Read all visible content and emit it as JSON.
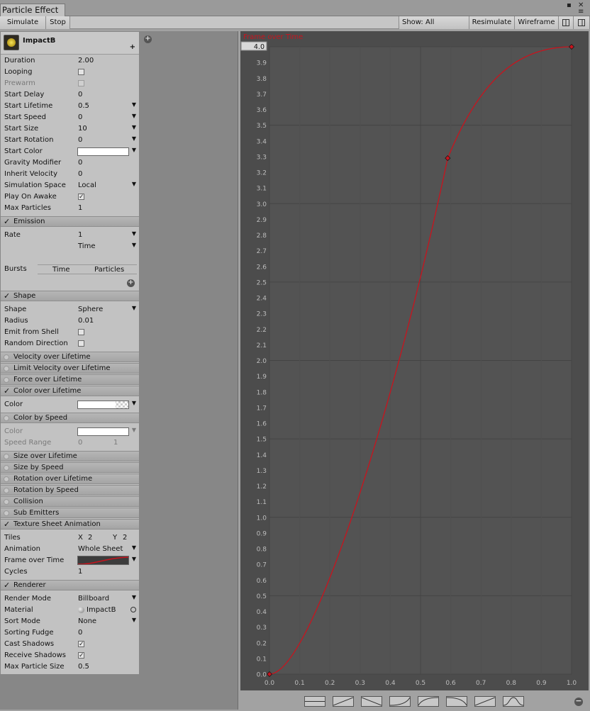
{
  "window": {
    "tab_title": "Particle Effect",
    "maximize_glyph": "▪",
    "close_glyph": "✕",
    "menu_glyph": "≡"
  },
  "toolbar": {
    "simulate": "Simulate",
    "stop": "Stop",
    "show": "Show: All",
    "resimulate": "Resimulate",
    "wireframe": "Wireframe"
  },
  "header": {
    "name": "ImpactB",
    "plus": "+"
  },
  "main_props": [
    {
      "label": "Duration",
      "value": "2.00"
    },
    {
      "label": "Looping",
      "check": ""
    },
    {
      "label": "Prewarm",
      "check": ""
    },
    {
      "label": "Start Delay",
      "value": "0"
    },
    {
      "label": "Start Lifetime",
      "value": "0.5"
    },
    {
      "label": "Start Speed",
      "value": "0"
    },
    {
      "label": "Start Size",
      "value": "10"
    },
    {
      "label": "Start Rotation",
      "value": "0"
    },
    {
      "label": "Start Color"
    },
    {
      "label": "Gravity Modifier",
      "value": "0"
    },
    {
      "label": "Inherit Velocity",
      "value": "0"
    },
    {
      "label": "Simulation Space",
      "value": "Local"
    },
    {
      "label": "Play On Awake",
      "check": "✓"
    },
    {
      "label": "Max Particles",
      "value": "1"
    }
  ],
  "emission": {
    "title": "Emission",
    "rate_label": "Rate",
    "rate_value": "1",
    "rate_unit": "Time",
    "bursts_label": "Bursts",
    "col_time": "Time",
    "col_particles": "Particles"
  },
  "shape": {
    "title": "Shape",
    "props": [
      {
        "label": "Shape",
        "value": "Sphere"
      },
      {
        "label": "Radius",
        "value": "0.01"
      },
      {
        "label": "Emit from Shell",
        "check": ""
      },
      {
        "label": "Random Direction",
        "check": ""
      }
    ]
  },
  "modules": {
    "velocity": "Velocity over Lifetime",
    "limit_velocity": "Limit Velocity over Lifetime",
    "force": "Force over Lifetime",
    "color_lifetime": "Color over Lifetime",
    "color_lifetime_color": "Color",
    "color_speed": "Color by Speed",
    "color_speed_color": "Color",
    "speed_range": "Speed Range",
    "speed_range_min": "0",
    "speed_range_max": "1",
    "size_lifetime": "Size over Lifetime",
    "size_speed": "Size by Speed",
    "rotation_lifetime": "Rotation over Lifetime",
    "rotation_speed": "Rotation by Speed",
    "collision": "Collision",
    "sub_emitters": "Sub Emitters"
  },
  "texture_sheet": {
    "title": "Texture Sheet Animation",
    "tiles_label": "Tiles",
    "tiles_x_label": "X",
    "tiles_x": "2",
    "tiles_y_label": "Y",
    "tiles_y": "2",
    "animation_label": "Animation",
    "animation_value": "Whole Sheet",
    "frame_label": "Frame over Time",
    "cycles_label": "Cycles",
    "cycles_value": "1"
  },
  "renderer": {
    "title": "Renderer",
    "props": [
      {
        "label": "Render Mode",
        "value": "Billboard"
      },
      {
        "label": "Material",
        "value": "ImpactB"
      },
      {
        "label": "Sort Mode",
        "value": "None"
      },
      {
        "label": "Sorting Fudge",
        "value": "0"
      },
      {
        "label": "Cast Shadows",
        "check": "✓"
      },
      {
        "label": "Receive Shadows",
        "check": "✓"
      },
      {
        "label": "Max Particle Size",
        "value": "0.5"
      }
    ]
  },
  "curve_editor": {
    "title": "Frame over Time",
    "max_field": "4.0",
    "y_ticks": [
      "0.0",
      "0.1",
      "0.2",
      "0.3",
      "0.4",
      "0.5",
      "0.6",
      "0.7",
      "0.8",
      "0.9",
      "1.0",
      "1.1",
      "1.2",
      "1.3",
      "1.4",
      "1.5",
      "1.6",
      "1.7",
      "1.8",
      "1.9",
      "2.0",
      "2.1",
      "2.2",
      "2.3",
      "2.4",
      "2.5",
      "2.6",
      "2.7",
      "2.8",
      "2.9",
      "3.0",
      "3.1",
      "3.2",
      "3.3",
      "3.4",
      "3.5",
      "3.6",
      "3.7",
      "3.8",
      "3.9"
    ],
    "x_ticks": [
      "0.0",
      "0.1",
      "0.2",
      "0.3",
      "0.4",
      "0.5",
      "0.6",
      "0.7",
      "0.8",
      "0.9",
      "1.0"
    ],
    "keys": [
      {
        "t": 0.0,
        "v": 0.0
      },
      {
        "t": 0.59,
        "v": 3.29
      },
      {
        "t": 1.0,
        "v": 4.0
      }
    ],
    "curve_color": "#c8141e",
    "presets": [
      "flat",
      "linear-up",
      "linear-down",
      "ease-in",
      "ease-out",
      "ease-down",
      "linear-up-2",
      "sine"
    ]
  }
}
